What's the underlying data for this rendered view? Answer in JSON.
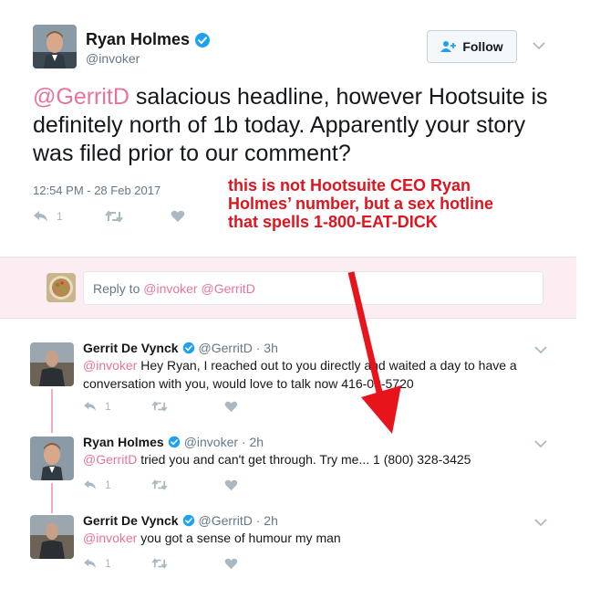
{
  "main_tweet": {
    "name": "Ryan Holmes",
    "handle": "@invoker",
    "follow_label": "Follow",
    "text_mention": "@GerritD",
    "text_body": " salacious headline, however Hootsuite is definitely north of 1b today. Apparently your story was filed prior to our comment?",
    "timestamp": "12:54 PM - 28 Feb 2017",
    "reply_count": "1"
  },
  "annotation": {
    "text": "this is not Hootsuite CEO Ryan Holmes’ number, but a sex hotline that spells 1-800-EAT-DICK"
  },
  "reply_box": {
    "prefix": "Reply to ",
    "mentions": "@invoker @GerritD"
  },
  "replies": [
    {
      "name": "Gerrit De Vynck",
      "meta": "@GerritD · 3h",
      "mention": "@invoker",
      "text": " Hey Ryan, I reached out to you directly and waited a day to have a conversation with you, would love to talk now 416-",
      "text_tail": "03-5720",
      "reply_count": "1"
    },
    {
      "name": "Ryan Holmes",
      "meta": "@invoker · 2h",
      "mention": "@GerritD",
      "text": " tried you and can't get through. Try me... 1 (800) 328-3425",
      "reply_count": "1"
    },
    {
      "name": "Gerrit De Vynck",
      "meta": "@GerritD · 2h",
      "mention": "@invoker",
      "text": " you got a sense of humour my man",
      "reply_count": "1"
    }
  ],
  "colors": {
    "mention": "#e8749b",
    "verified": "#1da1f2",
    "annotation": "#e0141e",
    "arrow": "#e8141c"
  }
}
